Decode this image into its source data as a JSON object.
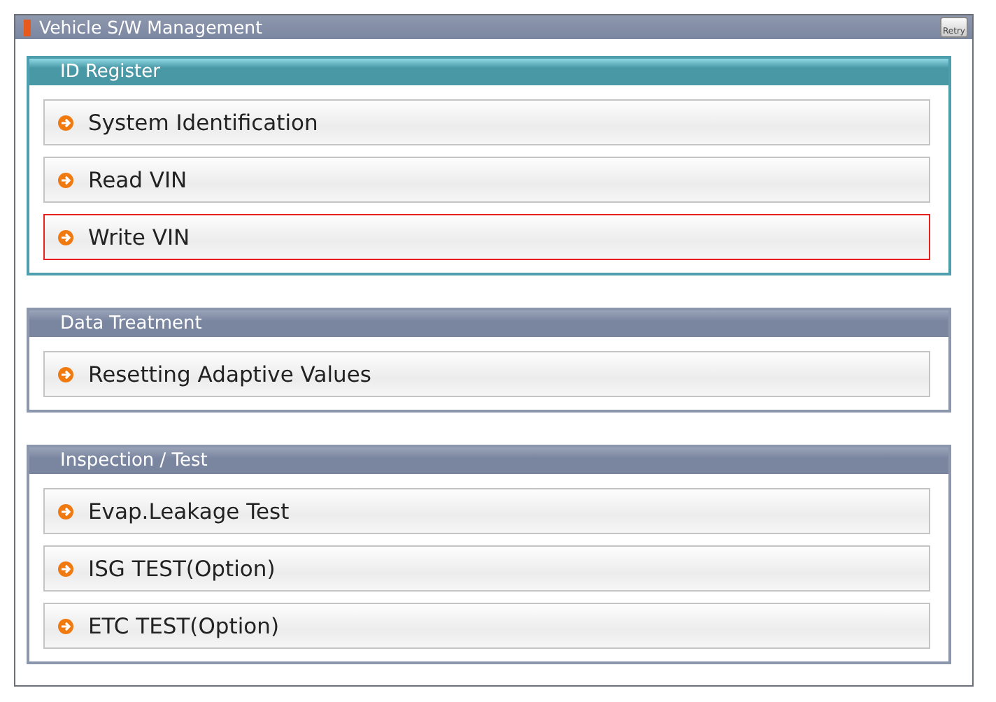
{
  "window": {
    "title": "Vehicle S/W Management",
    "retry_label": "Retry"
  },
  "sections": [
    {
      "title": "ID Register",
      "active": true,
      "items": [
        {
          "label": "System Identification",
          "selected": false
        },
        {
          "label": "Read VIN",
          "selected": false
        },
        {
          "label": "Write VIN",
          "selected": true
        }
      ]
    },
    {
      "title": "Data Treatment",
      "active": false,
      "items": [
        {
          "label": "Resetting Adaptive Values",
          "selected": false
        }
      ]
    },
    {
      "title": "Inspection / Test",
      "active": false,
      "items": [
        {
          "label": "Evap.Leakage Test",
          "selected": false
        },
        {
          "label": "ISG TEST(Option)",
          "selected": false
        },
        {
          "label": "ETC TEST(Option)",
          "selected": false
        }
      ]
    }
  ]
}
